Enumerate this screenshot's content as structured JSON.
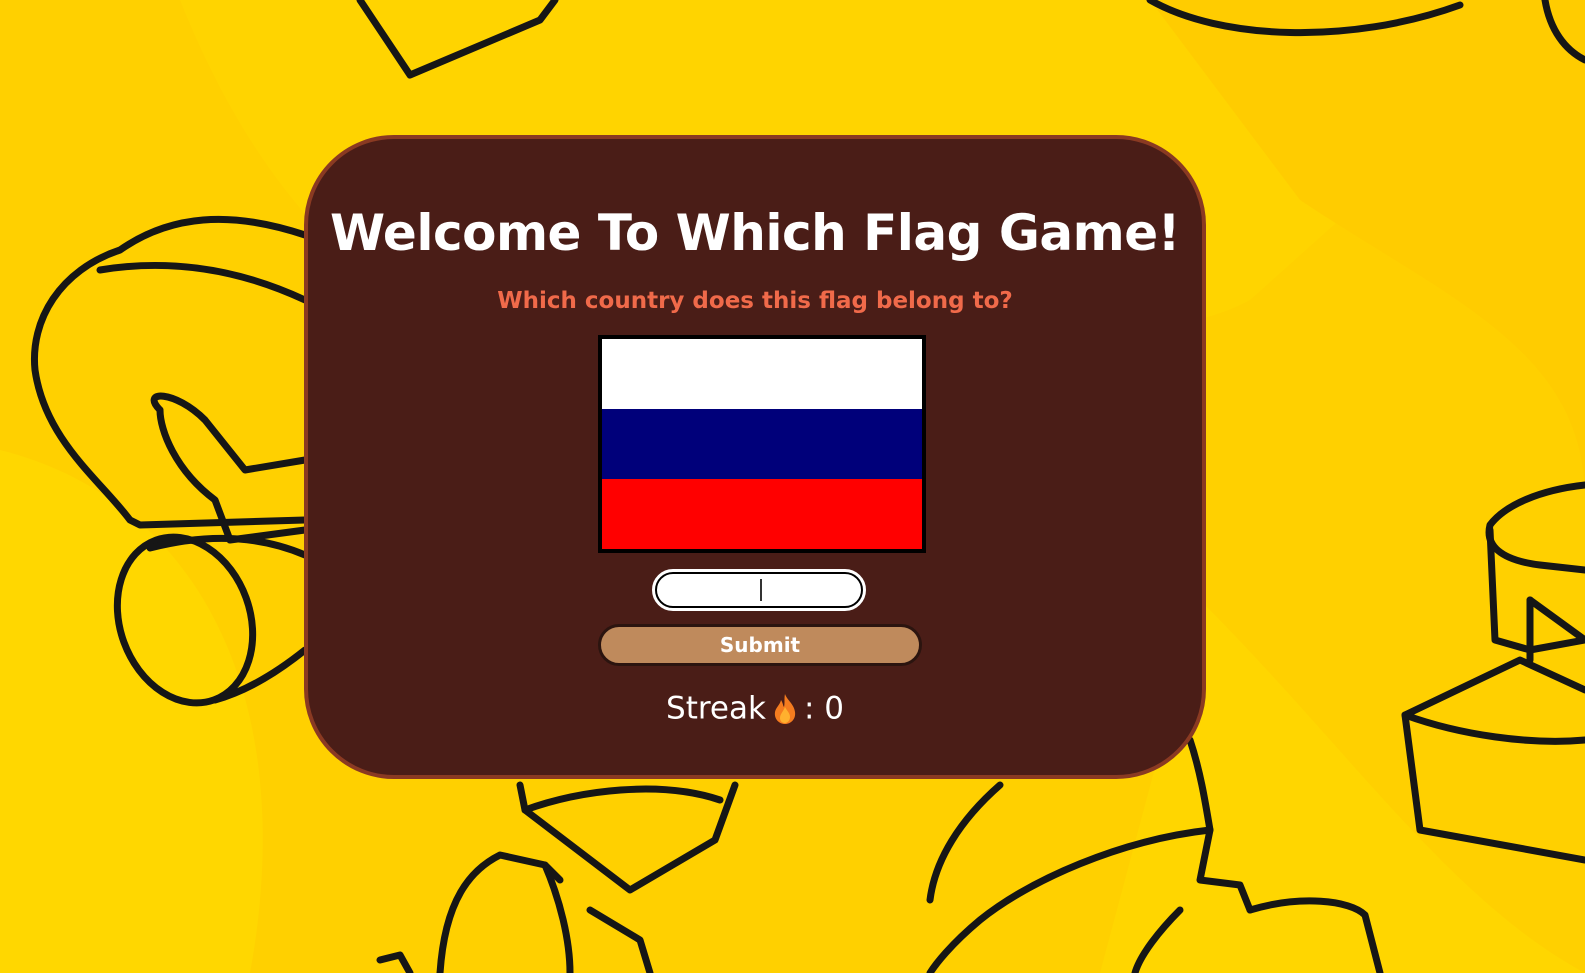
{
  "game": {
    "title": "Welcome To Which Flag Game!",
    "question": "Which country does this flag belong to?",
    "answer_value": "",
    "submit_label": "Submit",
    "streak_label": "Streak",
    "streak_icon": "fire-icon",
    "streak_separator": ": ",
    "streak_value": "0"
  },
  "flag": {
    "stripes": [
      "#ffffff",
      "#00007a",
      "#ff0000"
    ]
  },
  "colors": {
    "background": "#ffd000",
    "card": "#4a1d17",
    "card_border": "#8a3a22",
    "question": "#f06a4a",
    "button": "#bf8a5c"
  }
}
